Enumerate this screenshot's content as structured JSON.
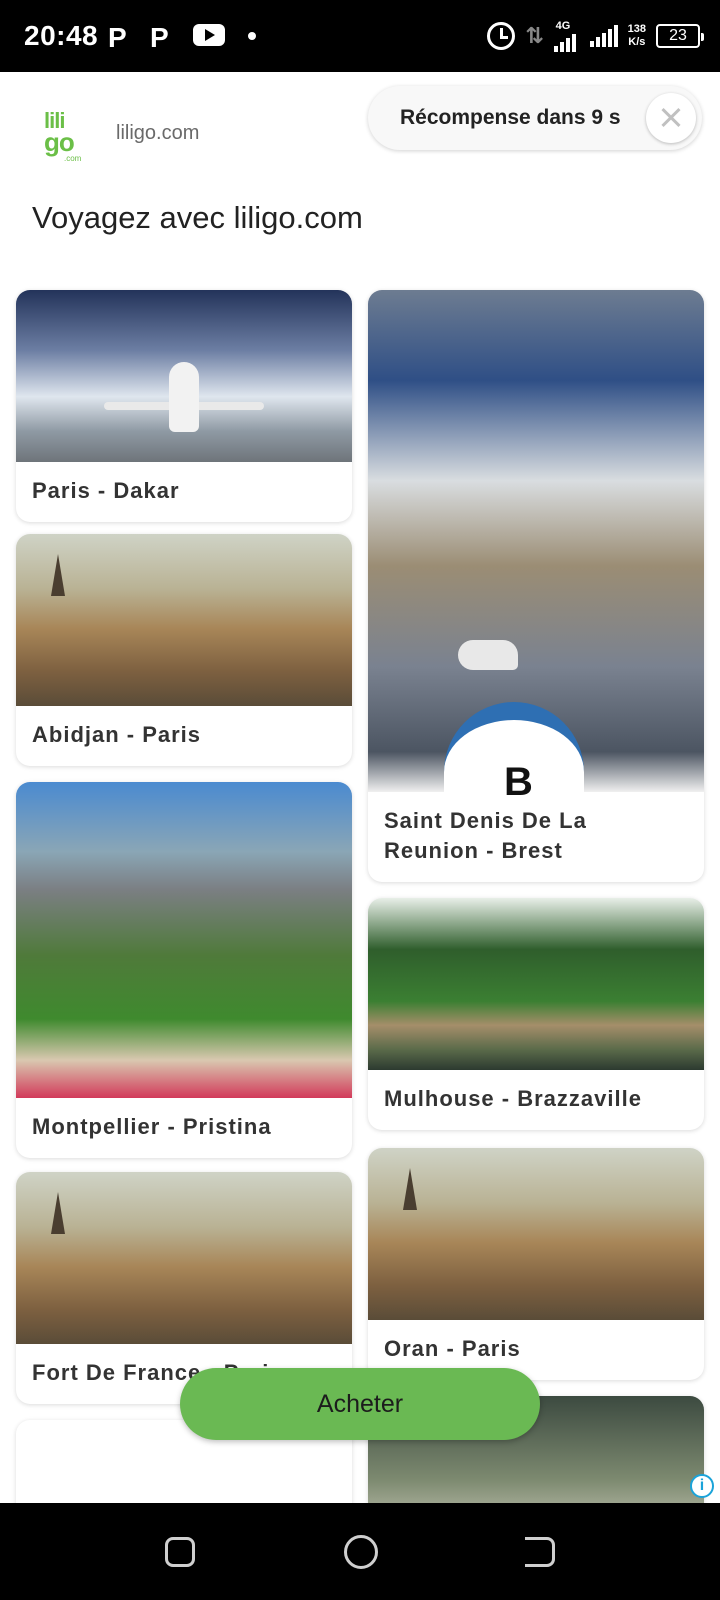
{
  "status_bar": {
    "time": "20:48",
    "app_icon_1": "P",
    "app_icon_2": "P",
    "network": "4G",
    "speed_value": "138",
    "speed_unit": "K/s",
    "battery": "23"
  },
  "header": {
    "logo_line1": "lili",
    "logo_line2": "go",
    "logo_line3": ".com",
    "domain": "liligo.com",
    "reward_text": "Récompense dans 9 s"
  },
  "headline": "Voyagez avec liligo.com",
  "cards": [
    {
      "label": "Paris - Dakar"
    },
    {
      "label": "Abidjan - Paris"
    },
    {
      "label": "Montpellier - Pristina"
    },
    {
      "label": "Fort De France - Paris"
    },
    {
      "label": "Saint Denis De La\nReunion - Brest"
    },
    {
      "label": "Mulhouse - Brazzaville"
    },
    {
      "label": "Oran - Paris"
    }
  ],
  "buoy_letter": "B",
  "cta": {
    "label": "Acheter"
  },
  "ad_info": "i",
  "colors": {
    "brand_green": "#6bbf47",
    "cta_green": "#6ab953",
    "ad_info_blue": "#1aa3d9"
  }
}
